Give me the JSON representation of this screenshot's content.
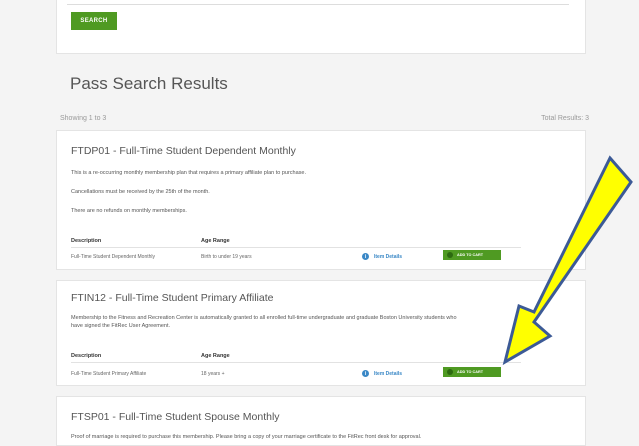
{
  "search": {
    "button_label": "SEARCH"
  },
  "results": {
    "title": "Pass Search Results",
    "showing": "Showing 1 to 3",
    "total": "Total Results: 3"
  },
  "cards": [
    {
      "title": "FTDP01 - Full-Time Student Dependent Monthly",
      "paragraphs": [
        "This is a re-occurring monthly membership plan that requires a primary affiliate plan to purchase.",
        "Cancellations must be received by the 25th of the month.",
        "There are no refunds on monthly memberships."
      ],
      "col_description": "Description",
      "col_age": "Age Range",
      "row_description": "Full-Time Student Dependent Monthly",
      "row_age": "Birth to under 19 years",
      "details_label": "Item Details",
      "cart_label": "ADD TO CART"
    },
    {
      "title": "FTIN12 - Full-Time Student Primary Affiliate",
      "paragraphs": [
        "Membership to the Fitness and Recreation Center is automatically granted to all enrolled full-time undergraduate and graduate Boston University students who",
        "have signed the FitRec User Agreement."
      ],
      "col_description": "Description",
      "col_age": "Age Range",
      "row_description": "Full-Time Student Primary Affiliate",
      "row_age": "18 years +",
      "details_label": "Item Details",
      "cart_label": "ADD TO CART"
    },
    {
      "title": "FTSP01 - Full-Time Student Spouse Monthly",
      "paragraphs": [
        "Proof of marriage is required to purchase this membership. Please bring a copy of your marriage certificate to the FitRec front desk for approval."
      ]
    }
  ],
  "colors": {
    "accent_green": "#4f9a22",
    "link_blue": "#3a88c6",
    "arrow_yellow": "#ffff00",
    "arrow_outline": "#3c5a96"
  }
}
